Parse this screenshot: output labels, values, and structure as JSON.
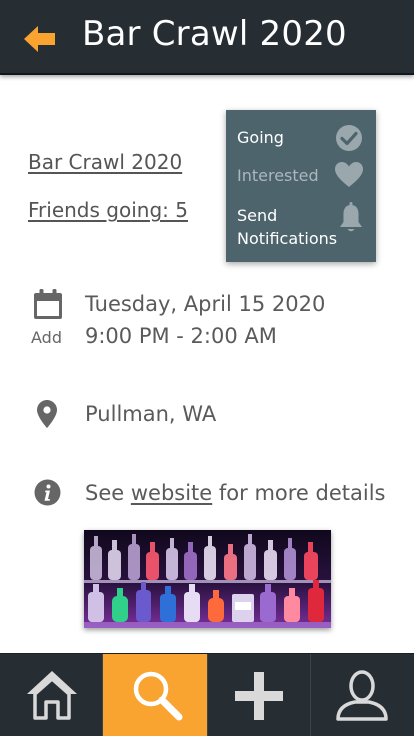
{
  "header": {
    "title": "Bar Crawl 2020"
  },
  "event": {
    "name_link": "Bar Crawl 2020",
    "friends_link": "Friends going: 5",
    "date_line": "Tuesday, April 15 2020",
    "time_line": "9:00 PM - 2:00 AM",
    "add_label": "Add",
    "location": "Pullman, WA",
    "details_prefix": "See ",
    "details_link": "website",
    "details_suffix": " for more details"
  },
  "rsvp": {
    "going": "Going",
    "interested": "Interested",
    "send_line1": "Send",
    "send_line2": "Notifications"
  },
  "nav": {
    "active": "search"
  },
  "colors": {
    "header_bg": "#262e34",
    "accent": "#f9a430",
    "panel_bg": "#4e646d"
  }
}
